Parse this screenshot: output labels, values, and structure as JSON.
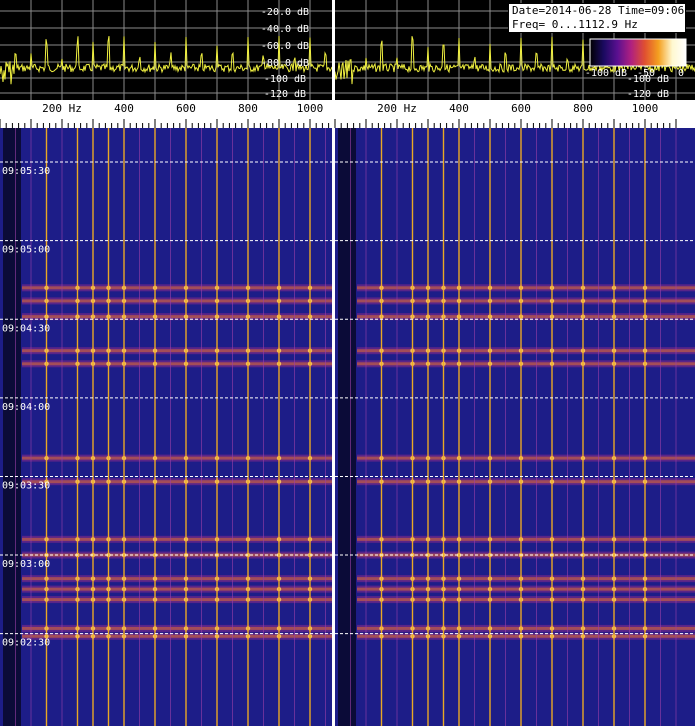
{
  "info": {
    "line1": "Date=2014-06-28 Time=09:06",
    "line2": "Freq= 0...1112.9 Hz"
  },
  "colorbar": {
    "labels": [
      "-100 dB",
      "-50",
      "0"
    ],
    "stops": [
      "#000000",
      "#1a0a60",
      "#5a1090",
      "#b02080",
      "#e05030",
      "#f4a020",
      "#fff8d0",
      "#ffffff"
    ]
  },
  "spectrum": {
    "db_labels": [
      "-20.0 dB",
      "-40.0 dB",
      "-60.0 dB",
      "-80.0 dB",
      "-100 dB",
      "-120 dB"
    ],
    "trace_color": "#f0f040",
    "grid_color": "#8a8a8a"
  },
  "chart_data": [
    {
      "type": "heatmap",
      "title": "",
      "xlabel": "Hz",
      "x_range_hz": [
        0,
        1112.9
      ],
      "x_ticks": [
        200,
        400,
        600,
        800,
        1000
      ],
      "x_tick_labels": [
        "200 Hz",
        "400",
        "600",
        "800",
        "1000"
      ],
      "y_time_labels": [
        "09:05:30",
        "09:05:00",
        "09:04:30",
        "09:04:00",
        "09:03:30",
        "09:03:00",
        "09:02:30"
      ],
      "db_range": [
        -120,
        -20
      ],
      "harmonic_lines_hz": [
        50,
        100,
        150,
        200,
        250,
        300,
        350,
        400,
        450,
        500,
        550,
        600,
        650,
        700,
        750,
        800,
        850,
        900,
        950,
        1000,
        1050,
        1100
      ],
      "strong_lines_hz": [
        150,
        250,
        300,
        350,
        400,
        500,
        600,
        700,
        800,
        900,
        1000
      ],
      "activity_times": [
        "09:04:42",
        "09:04:37",
        "09:04:31",
        "09:04:18",
        "09:04:13",
        "09:03:37",
        "09:03:28",
        "09:03:06",
        "09:03:00",
        "09:02:51",
        "09:02:47",
        "09:02:43",
        "09:02:32",
        "09:02:29"
      ],
      "background_color": "#1d1d88",
      "line_color": "#f4b020"
    },
    {
      "type": "heatmap",
      "title": "",
      "xlabel": "Hz",
      "x_range_hz": [
        0,
        1112.9
      ],
      "x_ticks": [
        200,
        400,
        600,
        800,
        1000
      ],
      "x_tick_labels": [
        "200 Hz",
        "400",
        "600",
        "800",
        "1000"
      ],
      "db_range": [
        -120,
        -20
      ],
      "harmonic_lines_hz": [
        50,
        100,
        150,
        200,
        250,
        300,
        350,
        400,
        450,
        500,
        550,
        600,
        650,
        700,
        750,
        800,
        850,
        900,
        950,
        1000,
        1050,
        1100
      ],
      "strong_lines_hz": [
        150,
        250,
        300,
        350,
        400,
        500,
        600,
        700,
        800,
        900,
        1000
      ],
      "activity_times": [
        "09:04:42",
        "09:04:37",
        "09:04:31",
        "09:04:18",
        "09:04:13",
        "09:03:37",
        "09:03:28",
        "09:03:06",
        "09:03:00",
        "09:02:51",
        "09:02:47",
        "09:02:43",
        "09:02:32",
        "09:02:29"
      ],
      "background_color": "#1d1d88",
      "line_color": "#f4b020"
    }
  ]
}
